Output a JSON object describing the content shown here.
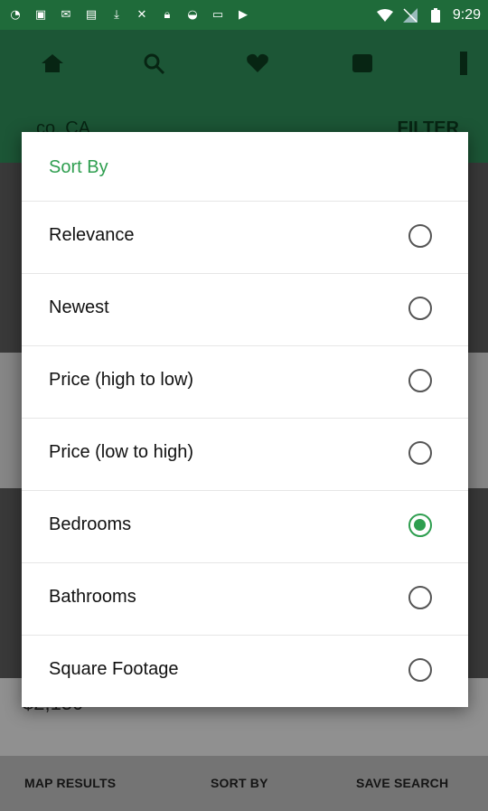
{
  "status_bar": {
    "time": "9:29",
    "left_icons": [
      "notification-icon",
      "gallery-icon",
      "mail-icon",
      "sim-icon",
      "download-icon",
      "no-signal-icon",
      "lock-icon",
      "android-icon",
      "inbox-icon",
      "play-icon"
    ],
    "right_icons": [
      "wifi-icon",
      "no-sim-icon",
      "battery-icon"
    ]
  },
  "header": {
    "nav_icons": [
      "home-icon",
      "search-icon",
      "heart-icon",
      "inbox-icon",
      "menu-icon"
    ],
    "location": "co, CA",
    "filter_label": "FILTER"
  },
  "background": {
    "price": "$2,150"
  },
  "modal": {
    "title": "Sort By",
    "options": [
      {
        "label": "Relevance",
        "checked": false
      },
      {
        "label": "Newest",
        "checked": false
      },
      {
        "label": "Price (high to low)",
        "checked": false
      },
      {
        "label": "Price (low to high)",
        "checked": false
      },
      {
        "label": "Bedrooms",
        "checked": true
      },
      {
        "label": "Bathrooms",
        "checked": false
      },
      {
        "label": "Square Footage",
        "checked": false
      }
    ]
  },
  "bottom_bar": {
    "map_results": "MAP RESULTS",
    "sort_by": "SORT BY",
    "save_search": "SAVE SEARCH"
  },
  "colors": {
    "accent": "#2e9e4f",
    "status_bar": "#1f6b3a"
  }
}
